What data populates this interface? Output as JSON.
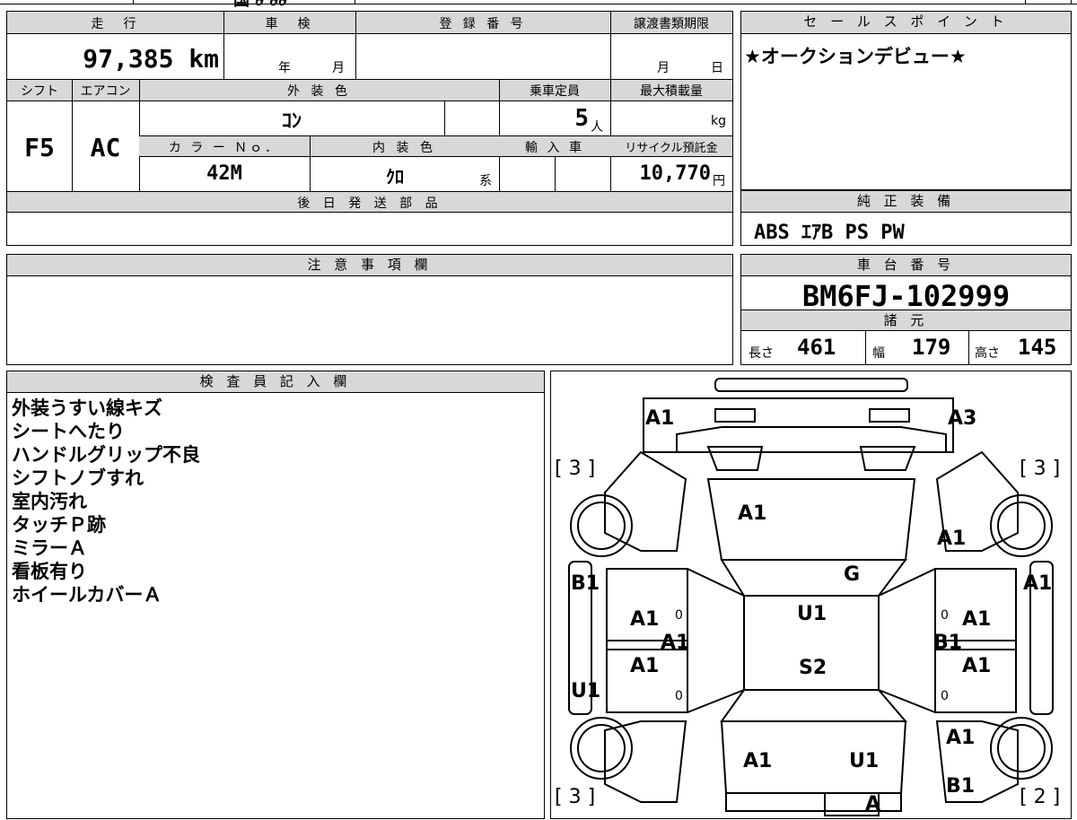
{
  "top_cut": {
    "text": "国 ∂ ∂∂"
  },
  "spec": {
    "headers": {
      "mileage": "走　行",
      "inspection": "車　検",
      "registration": "登 録 番 号",
      "transfer_deadline": "譲渡書類期限",
      "shift": "シフト",
      "aircon": "エアコン",
      "exterior_color": "外 装 色",
      "capacity": "乗車定員",
      "max_load": "最大積載量",
      "color_no": "カ ラ ー Ｎｏ．",
      "interior_color": "内 装 色",
      "import": "輸 入 車",
      "recycle": "リサイクル預託金",
      "later_parts": "後 日 発 送 部 品"
    },
    "mileage_value": "97,385 km",
    "inspection_year": "年",
    "inspection_month": "月",
    "deadline_month": "月",
    "deadline_day": "日",
    "shift_value": "F5",
    "aircon_value": "AC",
    "exterior_color_value": "ｺﾝ",
    "capacity_value": "5",
    "capacity_unit": "人",
    "load_unit": "kg",
    "color_no_value": "42M",
    "interior_color_value": "ｸﾛ",
    "interior_suffix": "系",
    "recycle_value": "10,770",
    "recycle_unit": "円"
  },
  "sales_point": {
    "header": "セ ー ル ス ポ イ ン ト",
    "text": "★オークションデビュー★"
  },
  "equipment": {
    "header": "純 正 装 備",
    "text": "ABS ｴｱB PS PW"
  },
  "notes": {
    "header": "注 意 事 項 欄"
  },
  "chassis": {
    "header": "車 台 番 号",
    "value": "BM6FJ-102999"
  },
  "dimensions": {
    "header": "諸 元",
    "length_label": "長さ",
    "length_value": "461",
    "width_label": "幅",
    "width_value": "179",
    "height_label": "高さ",
    "height_value": "145"
  },
  "inspector": {
    "header": "検 査 員 記 入 欄",
    "lines": [
      "外装うすい線キズ",
      "シートへたり",
      "ハンドルグリップ不良",
      "シフトノブすれ",
      "室内汚れ",
      "タッチＰ跡",
      "ミラーＡ",
      "看板有り",
      "ホイールカバーＡ"
    ]
  },
  "diagram": {
    "marks": {
      "front_left": "A1",
      "front_right": "A3",
      "bracket_tl": "[ 3 ]",
      "bracket_tr": "[ 3 ]",
      "bracket_bl": "[ 3 ]",
      "bracket_br": "[ 2 ]",
      "hood": "A1",
      "right_fender": "A1",
      "windshield": "G",
      "left_side": "B1",
      "right_side": "A1",
      "roof": "U1",
      "seat": "S2",
      "lf_door": "A1",
      "lf_door_center": "A1",
      "lr_door": "A1",
      "rf_door": "A1",
      "rf_door_center": "B1",
      "rr_door": "A1",
      "left_rocker": "U1",
      "right_quarter": "A1",
      "trunk_left": "A1",
      "trunk_right": "U1",
      "right_rear": "B1",
      "rear_bumper": "A",
      "zero_lf": "0",
      "zero_lr": "0",
      "zero_rf": "0",
      "zero_rr": "0"
    }
  }
}
